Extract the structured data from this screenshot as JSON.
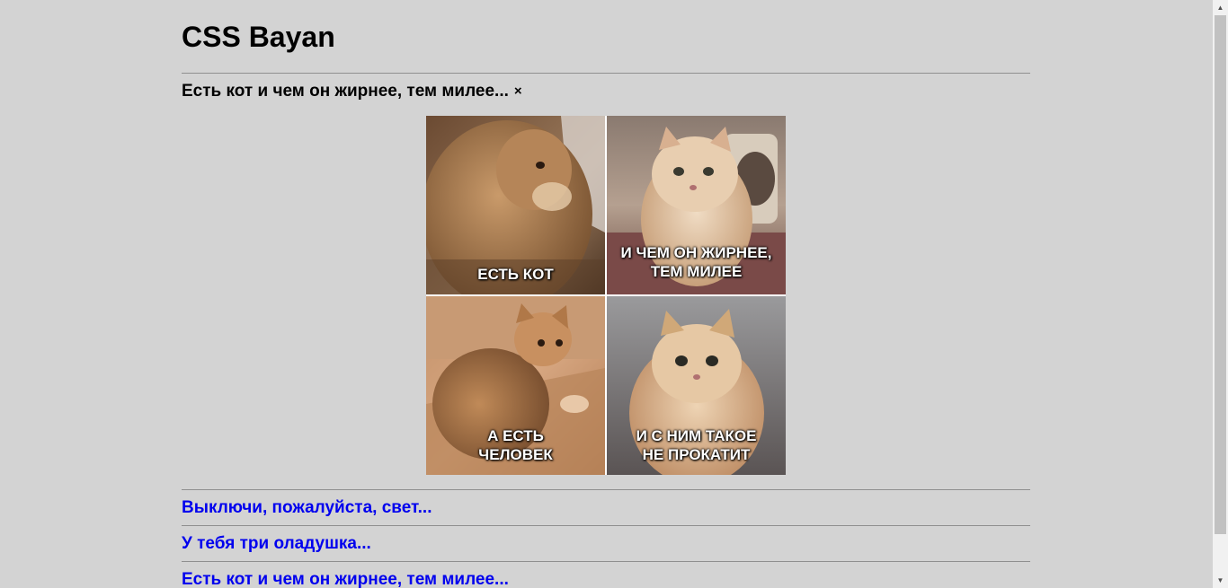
{
  "site": {
    "title": "CSS Bayan"
  },
  "open_post": {
    "title": "Есть кот и чем он жирнее, тем милее...",
    "close_symbol": "×",
    "panels": [
      {
        "caption": "ЕСТЬ КОТ"
      },
      {
        "caption": "И ЧЕМ ОН ЖИРНЕЕ,\nТЕМ МИЛЕЕ"
      },
      {
        "caption": "А ЕСТЬ\nЧЕЛОВЕК"
      },
      {
        "caption": "И С НИМ ТАКОЕ\nНЕ ПРОКАТИТ"
      }
    ]
  },
  "posts": [
    {
      "title": "Выключи, пожалуйста, свет..."
    },
    {
      "title": "У тебя три оладушка..."
    },
    {
      "title": "Есть кот и чем он жирнее, тем милее..."
    }
  ],
  "colors": {
    "background": "#d3d3d3",
    "link": "#0000ee",
    "text": "#000000"
  }
}
